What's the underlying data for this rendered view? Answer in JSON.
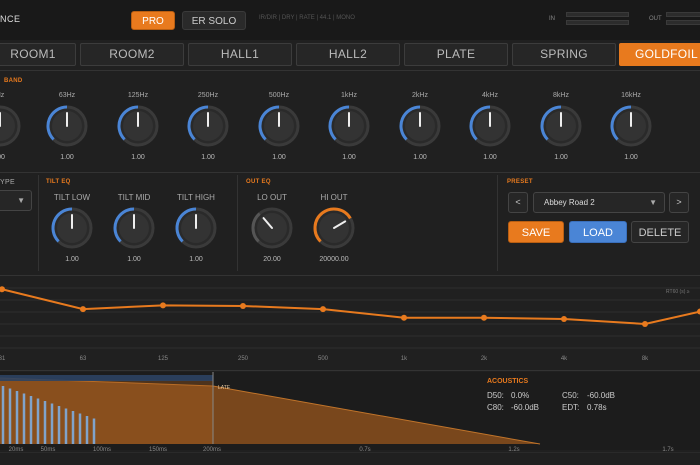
{
  "app": {
    "brand": "NCE"
  },
  "modes": {
    "pro": "PRO",
    "er_solo": "ER SOLO",
    "info": "IR/DIR | DRY | RATE | 44.1 | MONO",
    "in": "IN",
    "out": "OUT"
  },
  "tabs": [
    "ROOM1",
    "ROOM2",
    "HALL1",
    "HALL2",
    "PLATE",
    "SPRING",
    "GOLDFOIL"
  ],
  "band": {
    "title": "BAND",
    "freqs": [
      "Hz",
      "63Hz",
      "125Hz",
      "250Hz",
      "500Hz",
      "1kHz",
      "2kHz",
      "4kHz",
      "8kHz",
      "16kHz"
    ],
    "values": [
      ".00",
      "1.00",
      "1.00",
      "1.00",
      "1.00",
      "1.00",
      "1.00",
      "1.00",
      "1.00",
      "1.00"
    ]
  },
  "type_section": {
    "title": "YPE"
  },
  "tilt": {
    "title": "TILT EQ",
    "labels": [
      "TILT LOW",
      "TILT MID",
      "TILT HIGH"
    ],
    "values": [
      "1.00",
      "1.00",
      "1.00"
    ]
  },
  "outeq": {
    "title": "OUT EQ",
    "labels": [
      "LO OUT",
      "HI OUT"
    ],
    "values": [
      "20.00",
      "20000.00"
    ]
  },
  "preset": {
    "title": "PRESET",
    "current": "Abbey Road 2",
    "prev": "<",
    "next": ">",
    "save": "SAVE",
    "load": "LOAD",
    "delete": "DELETE"
  },
  "eq_graph": {
    "label": "RT60 (s) ≥",
    "ticks": [
      "31",
      "63",
      "125",
      "250",
      "500",
      "1k",
      "2k",
      "4k",
      "8k"
    ],
    "points": [
      0.98,
      0.66,
      0.72,
      0.71,
      0.66,
      0.52,
      0.52,
      0.5,
      0.42,
      0.62
    ],
    "color": "#e87a1e"
  },
  "ir": {
    "late_label": "LATE",
    "ticks": [
      "20ms",
      "50ms",
      "100ms",
      "150ms",
      "200ms",
      "0.7s",
      "1.2s",
      "1.7s"
    ]
  },
  "acoustics": {
    "title": "ACOUSTICS",
    "d50_label": "D50:",
    "d50": "0.0%",
    "c50_label": "C50:",
    "c50": "-60.0dB",
    "c80_label": "C80:",
    "c80": "-60.0dB",
    "edt_label": "EDT:",
    "edt": "0.78s"
  },
  "colors": {
    "accent": "#e87a1e",
    "blue": "#4a85d6",
    "bg": "#202020"
  }
}
